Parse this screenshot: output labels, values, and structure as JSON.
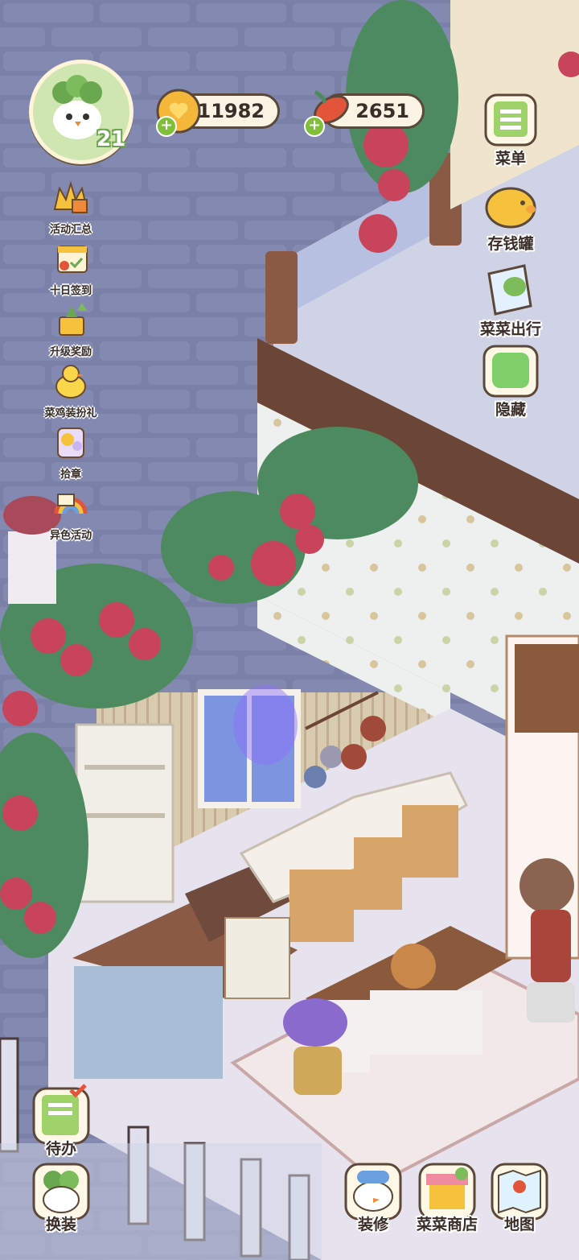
{
  "player": {
    "level": "21"
  },
  "resources": {
    "coins": "11982",
    "veggies": "2651"
  },
  "left_menu": [
    {
      "label": "活动汇总",
      "icon": "crown-gifts-icon"
    },
    {
      "label": "十日签到",
      "icon": "checkin-basket-icon"
    },
    {
      "label": "升级奖励",
      "icon": "level-up-reward-icon"
    },
    {
      "label": "菜鸡装扮礼",
      "icon": "chick-outfit-icon"
    },
    {
      "label": "拾章",
      "icon": "badge-scroll-icon"
    },
    {
      "label": "异色活动",
      "icon": "rainbow-event-icon"
    }
  ],
  "right_menu": [
    {
      "label": "菜单",
      "icon": "menu-board-icon"
    },
    {
      "label": "存钱罐",
      "icon": "piggy-bank-icon"
    },
    {
      "label": "菜菜出行",
      "icon": "travel-ticket-icon"
    },
    {
      "label": "隐藏",
      "icon": "hide-frame-icon"
    }
  ],
  "bottom_left": [
    {
      "label": "待办",
      "icon": "todo-list-icon"
    },
    {
      "label": "换装",
      "icon": "outfit-change-icon"
    }
  ],
  "bottom_right": [
    {
      "label": "装修",
      "icon": "decorate-duck-icon"
    },
    {
      "label": "菜菜商店",
      "icon": "shop-stall-icon"
    },
    {
      "label": "地图",
      "icon": "map-icon"
    }
  ],
  "colors": {
    "wall": "#7a80a8",
    "floor": "#d4cbe0",
    "rose": "#c8445a",
    "leaf": "#4e8a60",
    "wood": "#8b5a3c"
  }
}
